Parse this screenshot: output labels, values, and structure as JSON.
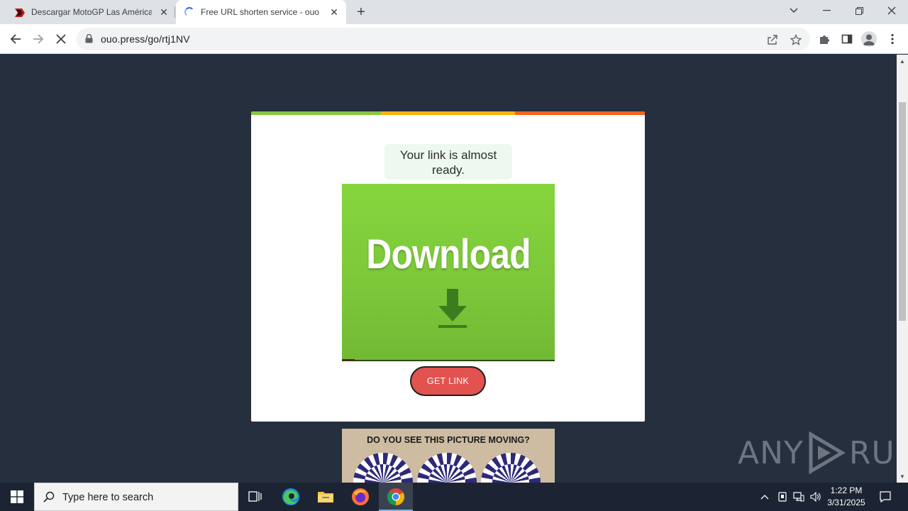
{
  "browser": {
    "tabs": [
      {
        "title": "Descargar MotoGP Las Américas",
        "active": false,
        "loading": false
      },
      {
        "title": "Free URL shorten service - ouo.p",
        "active": true,
        "loading": true
      }
    ],
    "url": "ouo.press/go/rtj1NV"
  },
  "page": {
    "stripe_colors": [
      "#8bc53f",
      "#f5b40f",
      "#f4621f"
    ],
    "headline": "Your link is almost ready.",
    "ad_banner": {
      "word": "Download",
      "icon": "download-arrow-icon",
      "background": "#7ec93a"
    },
    "get_link_label": "GET LINK",
    "get_link_color": "#e2524f",
    "ad2_title": "DO YOU SEE THIS PICTURE MOVING?"
  },
  "watermark": {
    "left": "ANY",
    "right": "RUN"
  },
  "taskbar": {
    "search_placeholder": "Type here to search",
    "apps": [
      "task-view-icon",
      "edge-icon",
      "file-explorer-icon",
      "firefox-icon",
      "chrome-icon"
    ],
    "clock_time": "1:22 PM",
    "clock_date": "3/31/2025"
  }
}
